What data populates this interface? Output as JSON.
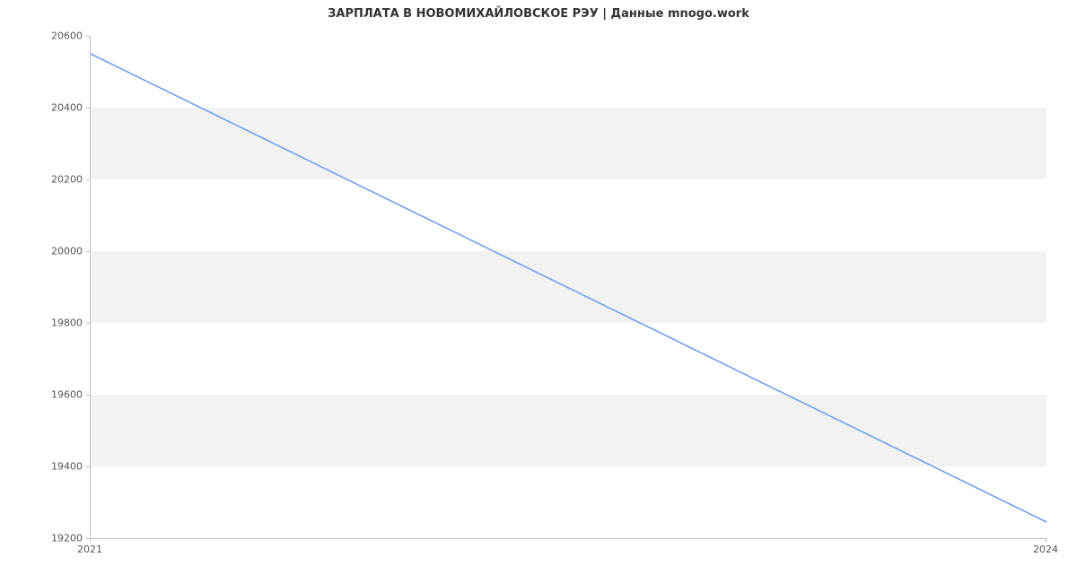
{
  "chart_data": {
    "type": "line",
    "title": "ЗАРПЛАТА В НОВОМИХАЙЛОВСКОЕ РЭУ | Данные mnogo.work",
    "xlabel": "",
    "ylabel": "",
    "x": [
      2021,
      2024
    ],
    "values": [
      20550,
      19245
    ],
    "xlim": [
      2021,
      2024
    ],
    "ylim": [
      19200,
      20600
    ],
    "x_ticks": [
      2021,
      2024
    ],
    "y_ticks": [
      19200,
      19400,
      19600,
      19800,
      20000,
      20200,
      20400,
      20600
    ],
    "line_color": "#6f9ef0"
  }
}
